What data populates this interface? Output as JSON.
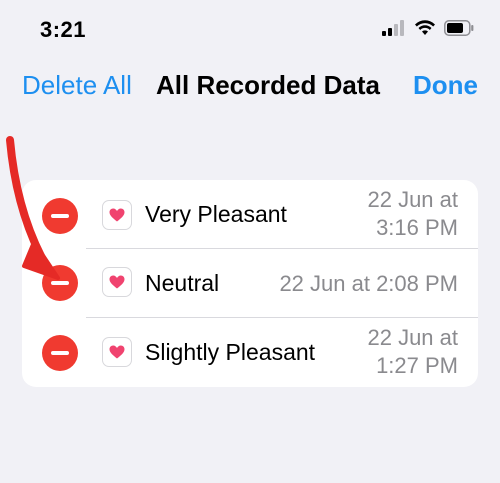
{
  "status_bar": {
    "time": "3:21"
  },
  "nav": {
    "left_button": "Delete All",
    "title": "All Recorded Data",
    "right_button": "Done"
  },
  "colors": {
    "accent": "#1d8ff0",
    "delete": "#f03a30",
    "heart": "#f0436f",
    "arrow": "#e52a26",
    "background": "#f1f1f6"
  },
  "records": [
    {
      "label": "Very Pleasant",
      "date_line1": "22 Jun at",
      "date_line2": "3:16 PM",
      "icon": "heart-icon"
    },
    {
      "label": "Neutral",
      "date_line1": "22 Jun at 2:08 PM",
      "icon": "heart-icon"
    },
    {
      "label": "Slightly Pleasant",
      "date_line1": "22 Jun at",
      "date_line2": "1:27 PM",
      "icon": "heart-icon"
    }
  ]
}
